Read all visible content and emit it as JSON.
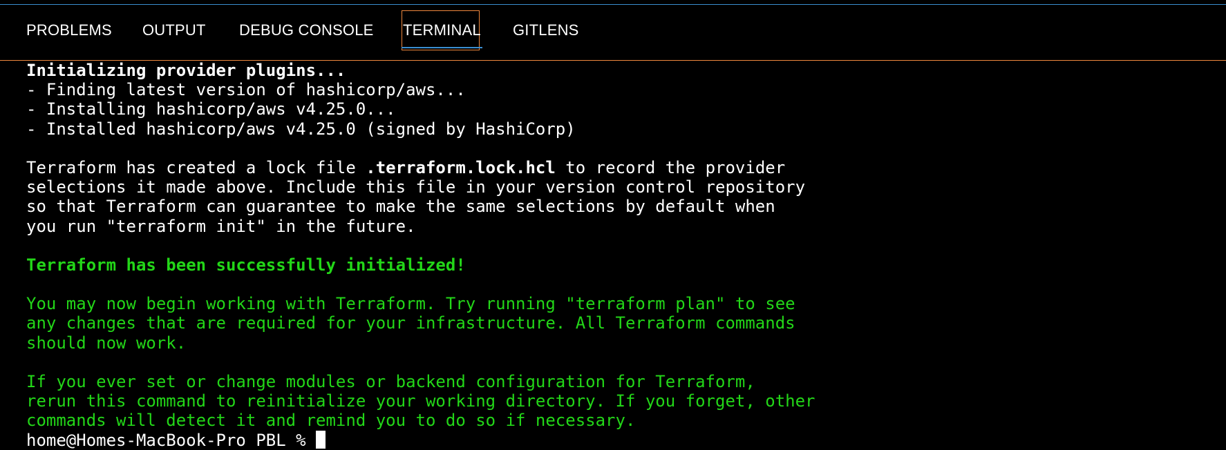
{
  "panel": {
    "tabs": [
      {
        "label": "PROBLEMS"
      },
      {
        "label": "OUTPUT"
      },
      {
        "label": "DEBUG CONSOLE"
      },
      {
        "label": "TERMINAL"
      },
      {
        "label": "GITLENS"
      }
    ],
    "active_tab": "TERMINAL"
  },
  "terminal": {
    "lines": [
      "Initializing provider plugins...",
      "- Finding latest version of hashicorp/aws...",
      "- Installing hashicorp/aws v4.25.0...",
      "- Installed hashicorp/aws v4.25.0 (signed by HashiCorp)",
      "",
      {
        "pre": "Terraform has created a lock file ",
        "bold": ".terraform.lock.hcl",
        "post": " to record the provider"
      },
      "selections it made above. Include this file in your version control repository",
      "so that Terraform can guarantee to make the same selections by default when",
      "you run \"terraform init\" in the future.",
      "",
      "Terraform has been successfully initialized!",
      "",
      "You may now begin working with Terraform. Try running \"terraform plan\" to see",
      "any changes that are required for your infrastructure. All Terraform commands",
      "should now work.",
      "",
      "If you ever set or change modules or backend configuration for Terraform,",
      "rerun this command to reinitialize your working directory. If you forget, other",
      "commands will detect it and remind you to do so if necessary."
    ],
    "prompt": "home@Homes-MacBook-Pro PBL % "
  },
  "colors": {
    "success_green": "#23d618",
    "active_tab_border": "#f0883e",
    "accent_blue": "#3b8fd1"
  }
}
